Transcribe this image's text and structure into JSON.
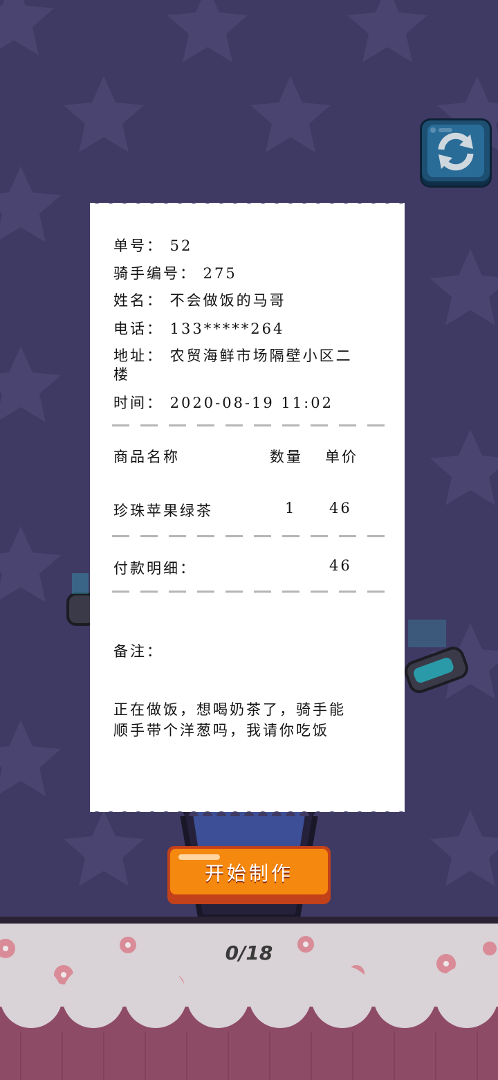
{
  "receipt": {
    "order_no": "单号： 52",
    "rider_no": "骑手编号： 275",
    "name": "姓名： 不会做饭的马哥",
    "phone": "电话： 133*****264",
    "address_line1": "地址： 农贸海鲜市场隔壁小区二",
    "address_line2": "楼",
    "time": "时间： 2020-08-19 11:02",
    "headers": {
      "item": "商品名称",
      "qty": "数量",
      "price": "单价"
    },
    "items": [
      {
        "name": "珍珠苹果绿茶",
        "qty": "1",
        "price": "46"
      }
    ],
    "payment_label": "付款明细：",
    "payment_total": "46",
    "note_label": "备注：",
    "note_line1": "正在做饭，想喝奶茶了，骑手能",
    "note_line2": "顺手带个洋葱吗，我请你吃饭"
  },
  "start_button": {
    "label": "开始制作"
  },
  "progress": {
    "text": "0/18",
    "current": 0,
    "total": 18
  },
  "icons": {
    "refresh": "refresh-icon",
    "background": "star-icon"
  },
  "colors": {
    "background": "#3f3a63",
    "button_orange": "#f5880f",
    "refresh_blue": "#2a6c98",
    "receipt": "#ffffff"
  }
}
